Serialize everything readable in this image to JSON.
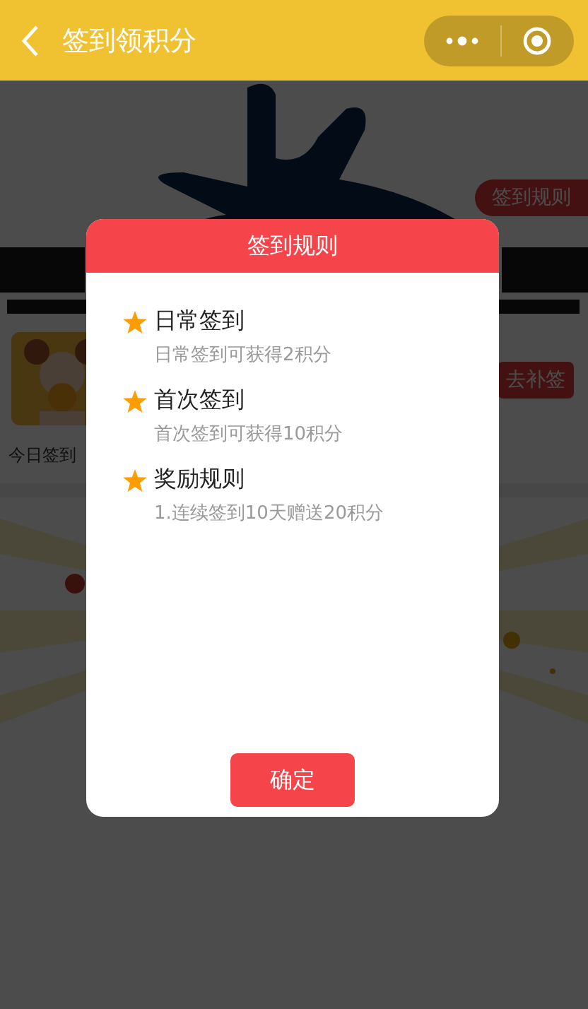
{
  "header": {
    "title": "签到领积分"
  },
  "page": {
    "rules_badge": "签到规则",
    "makeup_button": "去补签",
    "today_text": "今日签到"
  },
  "dialog": {
    "title": "签到规则",
    "rules": [
      {
        "title": "日常签到",
        "detail": "日常签到可获得2积分"
      },
      {
        "title": "首次签到",
        "detail": "首次签到可获得10积分"
      },
      {
        "title": "奖励规则",
        "detail": "1.连续签到10天赠送20积分"
      }
    ],
    "confirm_button": "确定"
  }
}
